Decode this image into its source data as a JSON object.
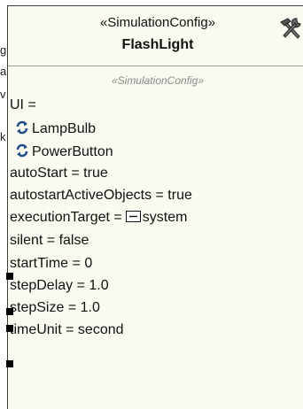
{
  "clipped_fragments": [
    "g",
    "a",
    "v",
    "k"
  ],
  "block": {
    "stereotype": "«SimulationConfig»",
    "name": "FlashLight",
    "header_icon": "tools-icon"
  },
  "compartment": {
    "stereotype": "«SimulationConfig»",
    "ui_label": "UI =",
    "ui_items": [
      {
        "label": "LampBulb",
        "icon": "refresh-icon"
      },
      {
        "label": "PowerButton",
        "icon": "refresh-icon"
      }
    ],
    "properties": {
      "autoStart": "autoStart = true",
      "autostartActiveObjects": "autostartActiveObjects = true",
      "executionTarget_label": "executionTarget =",
      "executionTarget_value": "system",
      "silent": "silent = false",
      "startTime": "startTime = 0",
      "stepDelay": "stepDelay = 1.0",
      "stepSize": "stepSize = 1.0",
      "timeUnit": "timeUnit = second"
    }
  },
  "colors": {
    "block_fill": "#fbfaf0",
    "border": "#3f3f3f",
    "refresh_icon": "#1f4f8a",
    "compartment_stereotype": "#8a8a8a"
  }
}
